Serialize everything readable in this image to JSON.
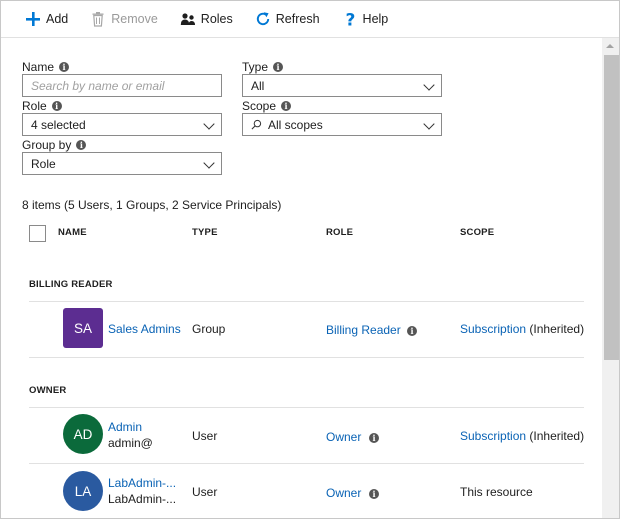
{
  "toolbar": {
    "add_label": "Add",
    "remove_label": "Remove",
    "roles_label": "Roles",
    "refresh_label": "Refresh",
    "help_label": "Help"
  },
  "filters": {
    "name_label": "Name",
    "name_placeholder": "Search by name or email",
    "type_label": "Type",
    "type_value": "All",
    "role_label": "Role",
    "role_value": "4 selected",
    "scope_label": "Scope",
    "scope_value": "All scopes",
    "groupby_label": "Group by",
    "groupby_value": "Role"
  },
  "summary": "8 items (5 Users, 1 Groups, 2 Service Principals)",
  "columns": {
    "name": "NAME",
    "type": "TYPE",
    "role": "ROLE",
    "scope": "SCOPE"
  },
  "groups": [
    {
      "title": "BILLING READER",
      "rows": [
        {
          "initials": "SA",
          "avatar_color": "#5c2d91",
          "name": "Sales Admins",
          "sub": "",
          "type": "Group",
          "role": "Billing Reader",
          "scope_link": "Subscription",
          "scope_note": "(Inherited)"
        }
      ]
    },
    {
      "title": "OWNER",
      "rows": [
        {
          "initials": "AD",
          "avatar_color": "#0b6a3b",
          "name": "Admin",
          "sub": "admin@",
          "type": "User",
          "role": "Owner",
          "scope_link": "Subscription",
          "scope_note": "(Inherited)"
        },
        {
          "initials": "LA",
          "avatar_color": "#2a5aa0",
          "name": "LabAdmin-...",
          "sub": "LabAdmin-...",
          "type": "User",
          "role": "Owner",
          "scope_text": "This resource"
        }
      ]
    }
  ],
  "colors": {
    "link": "#0a63b5",
    "accent": "#0078d4"
  }
}
